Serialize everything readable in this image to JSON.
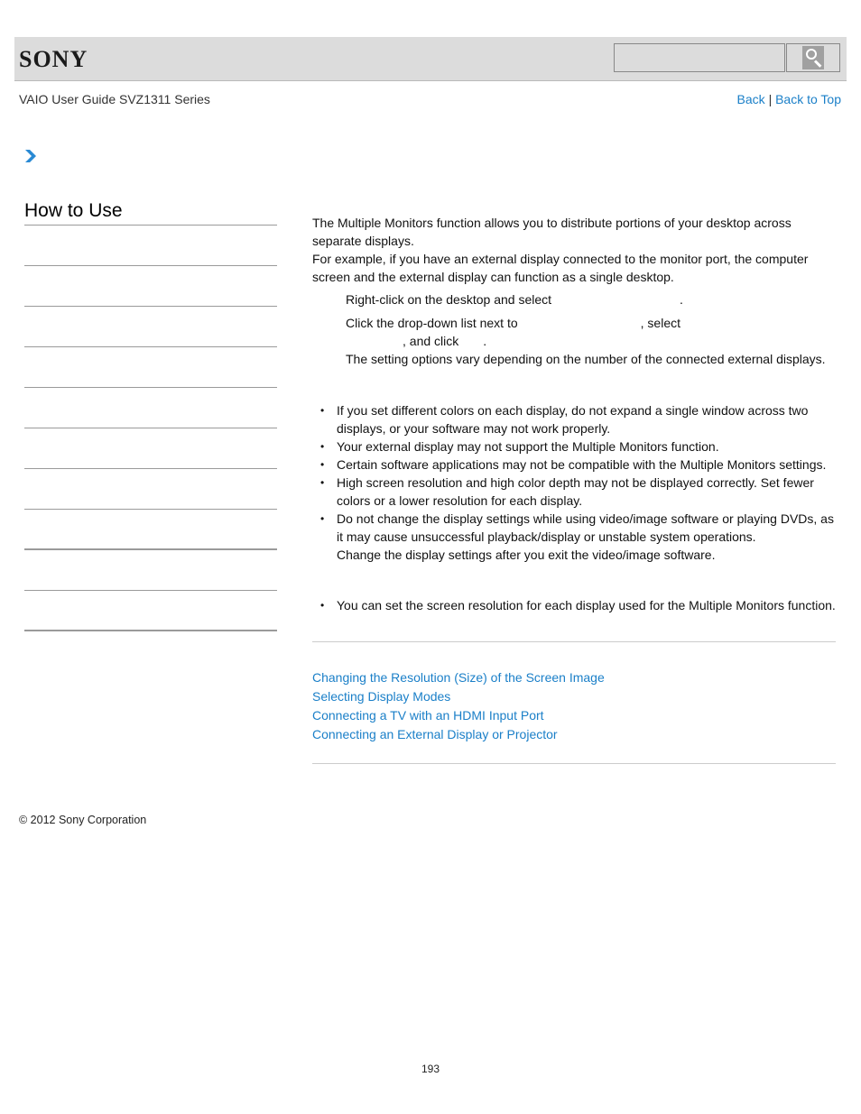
{
  "header": {
    "logo": "SONY",
    "search": {
      "placeholder": "",
      "value": ""
    },
    "search_button_icon": "search-icon"
  },
  "guide_title": "VAIO User Guide SVZ1311 Series",
  "top_links": {
    "back": "Back",
    "separator": "|",
    "back_to_top": "Back to Top"
  },
  "breadcrumb_icon": "chevron-right-icon",
  "sidebar": {
    "title": "How to Use",
    "items": [
      {
        "label": ""
      },
      {
        "label": ""
      },
      {
        "label": ""
      },
      {
        "label": ""
      },
      {
        "label": ""
      },
      {
        "label": ""
      },
      {
        "label": ""
      },
      {
        "label": ""
      },
      {
        "label": ""
      },
      {
        "label": ""
      }
    ]
  },
  "main": {
    "intro": [
      "The Multiple Monitors function allows you to distribute portions of your desktop across separate displays.",
      "For example, if you have an external display connected to the monitor port, the computer screen and the external display can function as a single desktop."
    ],
    "steps": [
      {
        "text_before": "Right-click on the desktop and select",
        "text_after": "."
      },
      {
        "line1_before": "Click the drop-down list next to",
        "line1_after": ", select",
        "line2_before": ", and click",
        "line2_after": ".",
        "note": "The setting options vary depending on the number of the connected external displays."
      }
    ],
    "notes": [
      "If you set different colors on each display, do not expand a single window across two displays, or your software may not work properly.",
      "Your external display may not support the Multiple Monitors function.",
      "Certain software applications may not be compatible with the Multiple Monitors settings.",
      "High screen resolution and high color depth may not be displayed correctly. Set fewer colors or a lower resolution for each display.",
      "Do not change the display settings while using video/image software or playing DVDs, as it may cause unsuccessful playback/display or unstable system operations.\nChange the display settings after you exit the video/image software."
    ],
    "hints": [
      "You can set the screen resolution for each display used for the Multiple Monitors function."
    ],
    "related_links": [
      "Changing the Resolution (Size) of the Screen Image",
      "Selecting Display Modes",
      "Connecting a TV with an HDMI Input Port",
      "Connecting an External Display or Projector"
    ]
  },
  "footer": {
    "copyright": "© 2012 Sony Corporation"
  },
  "page_number": "193",
  "colors": {
    "link": "#1a7fc8",
    "header_bg": "#dcdcdc",
    "divider": "#cccccc"
  }
}
